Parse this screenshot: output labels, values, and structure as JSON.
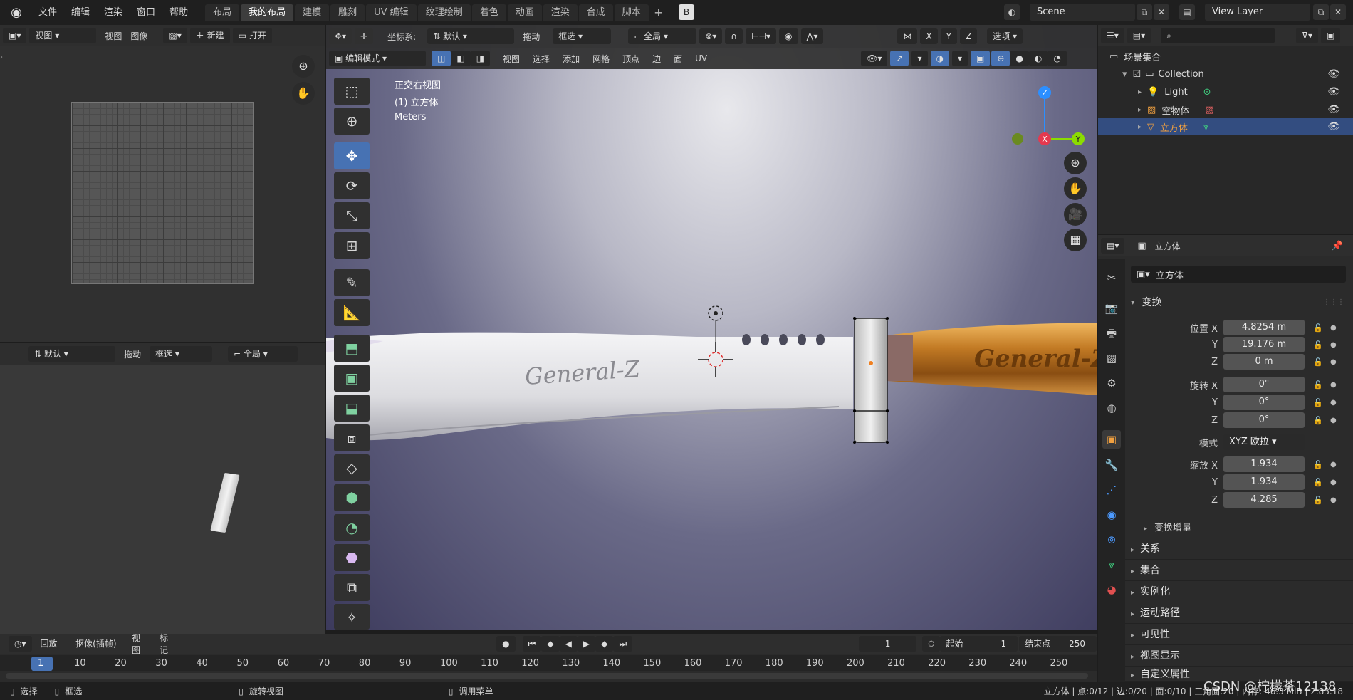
{
  "topbar": {
    "menus": [
      "文件",
      "编辑",
      "渲染",
      "窗口",
      "帮助"
    ],
    "workspaces": [
      "布局",
      "我的布局",
      "建模",
      "雕刻",
      "UV 编辑",
      "纹理绘制",
      "着色",
      "动画",
      "渲染",
      "合成",
      "脚本"
    ],
    "active_workspace_index": 1,
    "scene_label": "Scene",
    "view_layer_label": "View Layer"
  },
  "image_editor": {
    "view_menu": "视图",
    "menus": [
      "视图",
      "图像"
    ],
    "new_label": "新建",
    "open_label": "打开"
  },
  "viewport_header": {
    "coord_label": "坐标系:",
    "coord_value": "默认",
    "drag_label": "拖动",
    "drag_value": "框选",
    "transform_value": "全局",
    "axes": [
      "X",
      "Y",
      "Z"
    ],
    "options_label": "选项",
    "mode_value": "编辑模式",
    "menus": [
      "视图",
      "选择",
      "添加",
      "网格",
      "顶点",
      "边",
      "面",
      "UV"
    ]
  },
  "viewport_overlay": {
    "view_name": "正交右视图",
    "object_name": "(1) 立方体",
    "units": "Meters"
  },
  "model_text": {
    "blade_engraving": "General-Z",
    "handle_engraving": "General-Z"
  },
  "gizmo": {
    "z": "Z",
    "x": "X",
    "y": "Y"
  },
  "left_lower_header": {
    "coord_value": "默认",
    "drag_label": "拖动",
    "drag_value": "框选",
    "transform_value": "全局"
  },
  "outliner": {
    "root": "场景集合",
    "items": [
      {
        "label": "Collection",
        "depth": 0
      },
      {
        "label": "Light",
        "depth": 1
      },
      {
        "label": "空物体",
        "depth": 1
      },
      {
        "label": "立方体",
        "depth": 1,
        "selected": true
      }
    ]
  },
  "properties": {
    "header_object": "立方体",
    "object_name": "立方体",
    "transform_title": "变换",
    "rows": [
      {
        "label": "位置 X",
        "value": "4.8254 m"
      },
      {
        "label": "Y",
        "value": "19.176 m"
      },
      {
        "label": "Z",
        "value": "0 m"
      },
      {
        "label": "旋转 X",
        "value": "0°"
      },
      {
        "label": "Y",
        "value": "0°"
      },
      {
        "label": "Z",
        "value": "0°"
      }
    ],
    "mode_label": "模式",
    "mode_value": "XYZ 欧拉",
    "scale_rows": [
      {
        "label": "缩放 X",
        "value": "1.934"
      },
      {
        "label": "Y",
        "value": "1.934"
      },
      {
        "label": "Z",
        "value": "4.285"
      }
    ],
    "delta_label": "变换增量",
    "sections": [
      "关系",
      "集合",
      "实例化",
      "运动路径",
      "可见性",
      "视图显示",
      "自定义属性"
    ]
  },
  "timeline": {
    "playback_label": "回放",
    "keying_label": "抠像(插帧)",
    "view_label": "视图",
    "marker_label": "标记",
    "current_frame": "1",
    "start_label": "起始",
    "start_value": "1",
    "end_label": "结束点",
    "end_value": "250",
    "ticks": [
      "1",
      "10",
      "20",
      "30",
      "40",
      "50",
      "60",
      "70",
      "80",
      "90",
      "100",
      "110",
      "120",
      "130",
      "140",
      "150",
      "160",
      "170",
      "180",
      "190",
      "200",
      "210",
      "220",
      "230",
      "240",
      "250"
    ]
  },
  "statusbar": {
    "select": "选择",
    "box_select": "框选",
    "rotate_view": "旋转视图",
    "call_menu": "调用菜单",
    "stats": "立方体 | 点:0/12 | 边:0/20 | 面:0/10 | 三角面:20 | 内存: 46.3 MiB | 2.83.18",
    "watermark": "CSDN @柠檬茶12138"
  },
  "colors": {
    "accent": "#4772b3",
    "selected_row": "#334d80",
    "axis_x": "#e5394f",
    "axis_y": "#8bdc00",
    "axis_z": "#2c8fff"
  }
}
